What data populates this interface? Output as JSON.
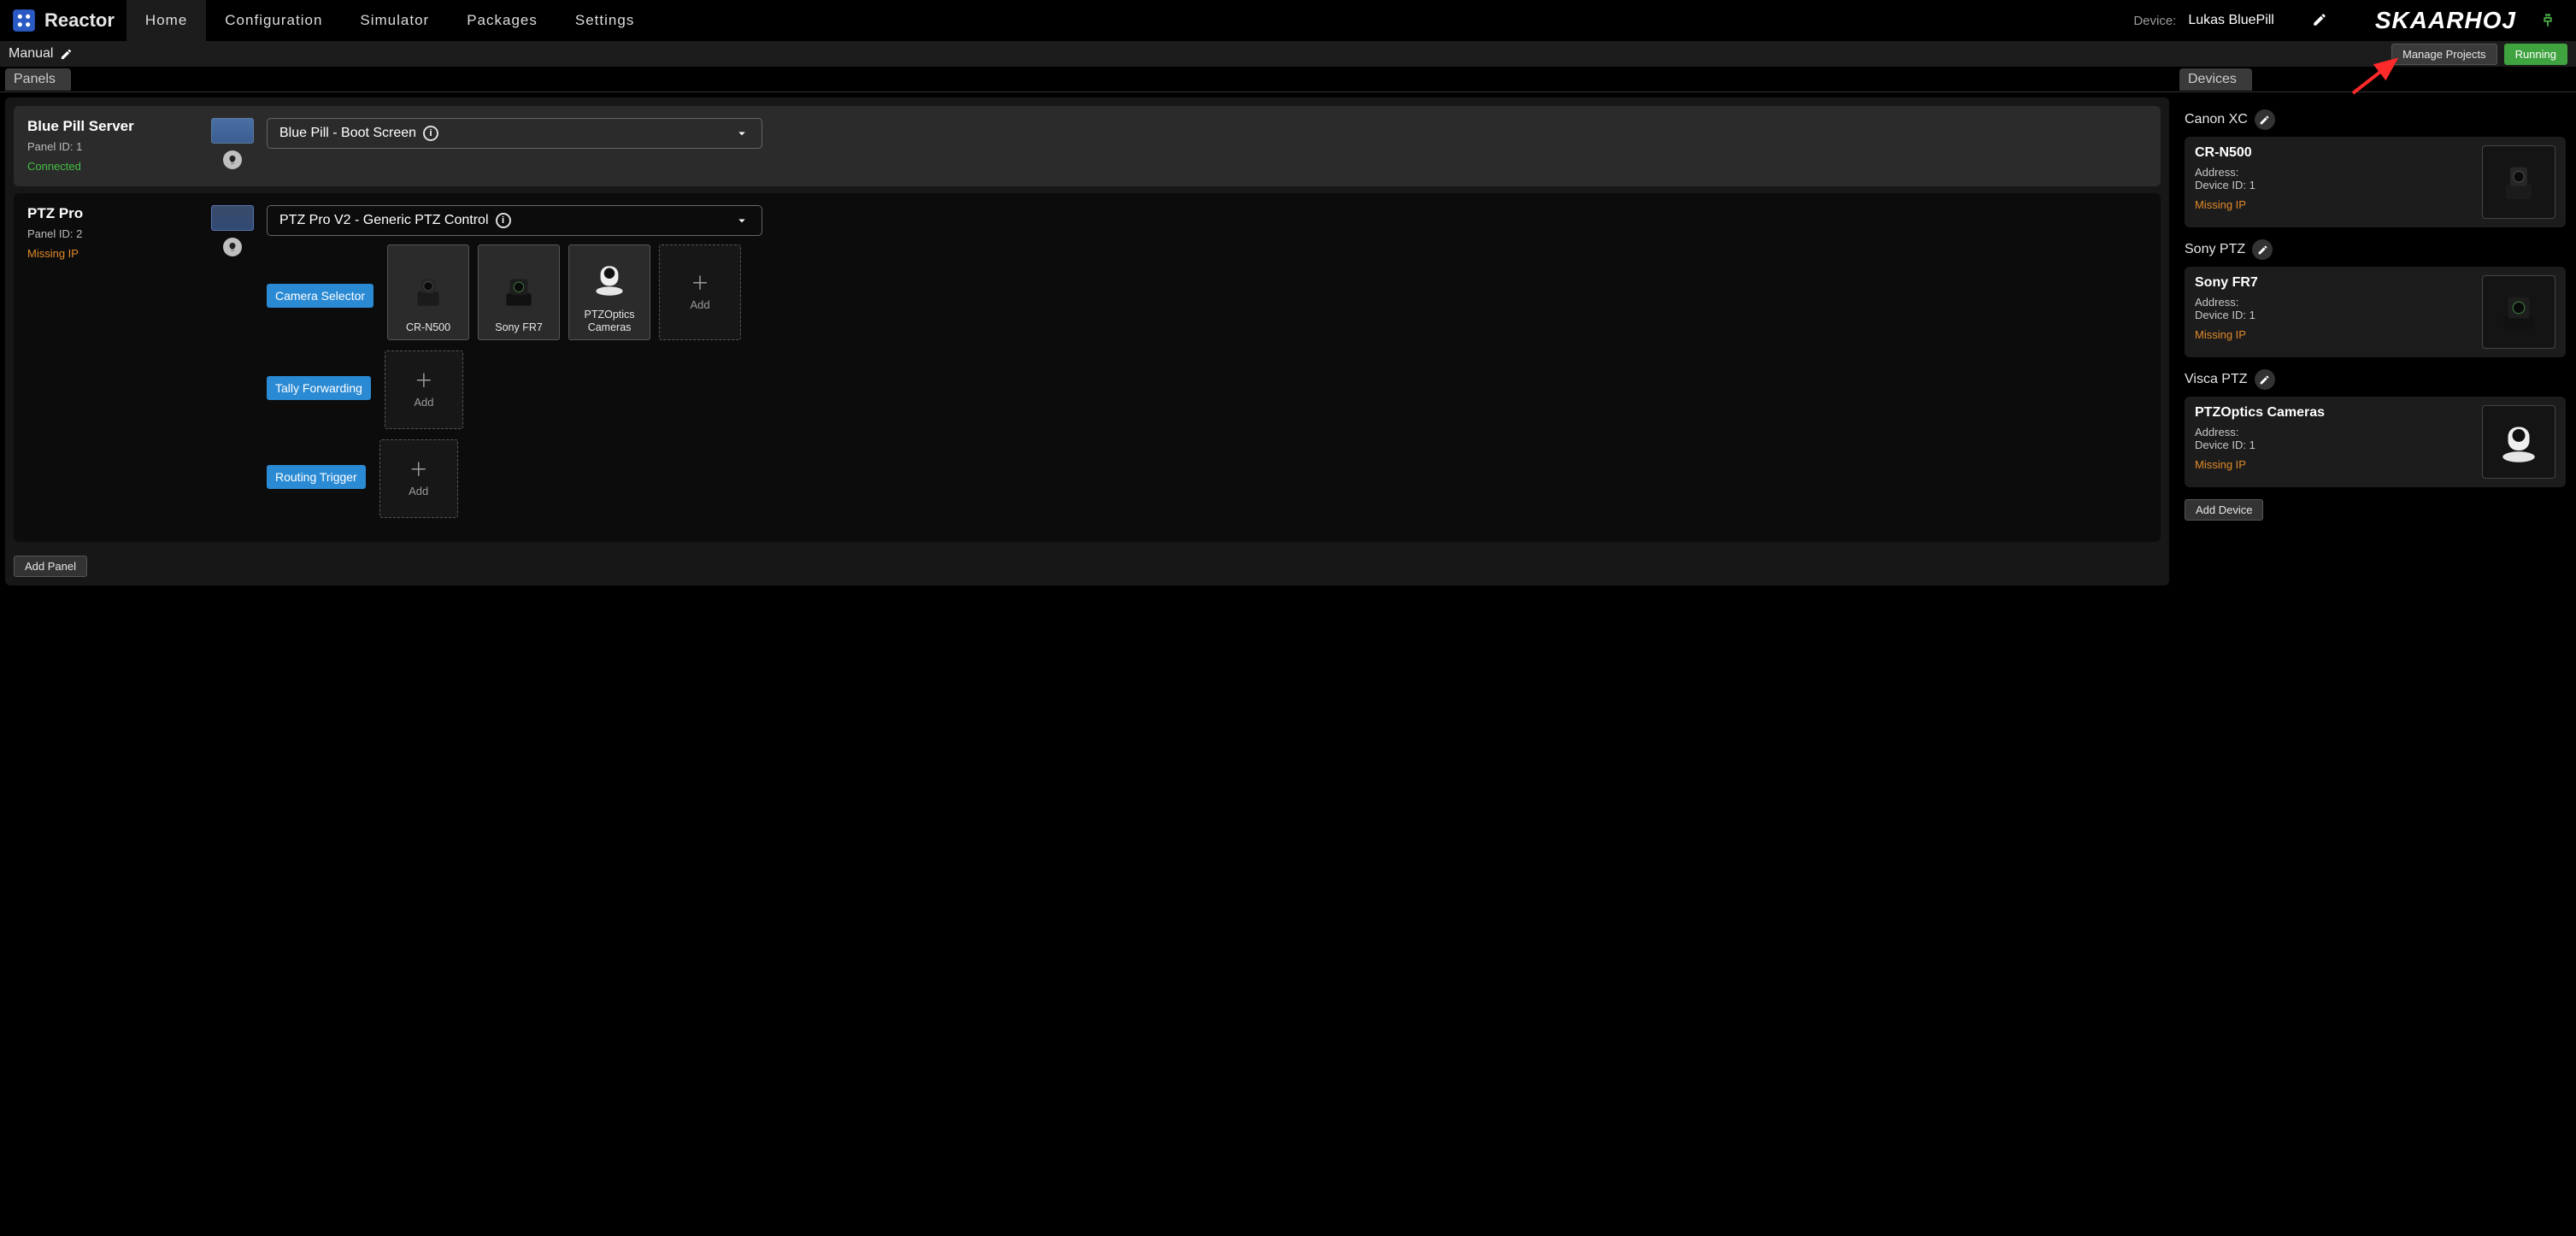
{
  "nav": {
    "brand": "Reactor",
    "items": [
      "Home",
      "Configuration",
      "Simulator",
      "Packages",
      "Settings"
    ],
    "active": "Home",
    "device_label": "Device:",
    "device_name": "Lukas BluePill",
    "company": "SKAARHOJ"
  },
  "subbar": {
    "title": "Manual",
    "manage_projects": "Manage Projects",
    "running": "Running"
  },
  "sections": {
    "panels_tab": "Panels",
    "devices_tab": "Devices"
  },
  "panels": [
    {
      "title": "Blue Pill Server",
      "panel_id": "Panel ID: 1",
      "status": "Connected",
      "status_color": "green",
      "select": "Blue Pill - Boot Screen"
    },
    {
      "title": "PTZ Pro",
      "panel_id": "Panel ID: 2",
      "status": "Missing IP",
      "status_color": "orange",
      "select": "PTZ Pro V2 - Generic PTZ Control",
      "rows": [
        {
          "label": "Camera Selector",
          "slots": [
            "CR-N500",
            "Sony FR7",
            "PTZOptics Cameras"
          ],
          "add": "Add"
        },
        {
          "label": "Tally Forwarding",
          "slots": [],
          "add": "Add"
        },
        {
          "label": "Routing Trigger",
          "slots": [],
          "add": "Add"
        }
      ]
    }
  ],
  "add_panel": "Add Panel",
  "device_groups": [
    {
      "name": "Canon XC",
      "devices": [
        {
          "title": "CR-N500",
          "address": "Address:",
          "device_id": "Device ID: 1",
          "status": "Missing IP"
        }
      ]
    },
    {
      "name": "Sony PTZ",
      "devices": [
        {
          "title": "Sony FR7",
          "address": "Address:",
          "device_id": "Device ID: 1",
          "status": "Missing IP"
        }
      ]
    },
    {
      "name": "Visca PTZ",
      "devices": [
        {
          "title": "PTZOptics Cameras",
          "address": "Address:",
          "device_id": "Device ID: 1",
          "status": "Missing IP"
        }
      ]
    }
  ],
  "add_device": "Add Device"
}
